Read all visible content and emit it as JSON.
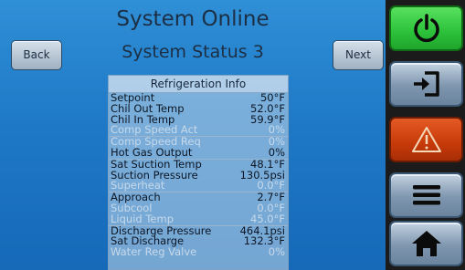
{
  "header": {
    "title": "System Online",
    "subtitle": "System Status 3"
  },
  "nav": {
    "back_label": "Back",
    "next_label": "Next"
  },
  "panel": {
    "title": "Refrigeration Info",
    "rows": [
      {
        "label": "Setpoint",
        "value": "50",
        "unit": "°F",
        "dim": false
      },
      {
        "label": "Chil Out Temp",
        "value": "52.0",
        "unit": "°F",
        "dim": false
      },
      {
        "label": "Chil In Temp",
        "value": "59.9",
        "unit": "°F",
        "dim": false
      },
      {
        "label": "Comp Speed Act",
        "value": "0",
        "unit": "%",
        "dim": true
      },
      {
        "label": "Comp Speed Req",
        "value": "0",
        "unit": "%",
        "dim": true
      },
      {
        "label": "Hot Gas Output",
        "value": "0",
        "unit": "%",
        "dim": false
      },
      {
        "label": "Sat Suction Temp",
        "value": "48.1",
        "unit": "°F",
        "dim": false
      },
      {
        "label": "Suction Pressure",
        "value": "130.5",
        "unit": "psi",
        "dim": false
      },
      {
        "label": "Superheat",
        "value": "0.0",
        "unit": "°F",
        "dim": true
      },
      {
        "label": "Approach",
        "value": "2.7",
        "unit": "°F",
        "dim": false
      },
      {
        "label": "Subcool",
        "value": "0.0",
        "unit": "°F",
        "dim": true
      },
      {
        "label": "Liquid Temp",
        "value": "45.0",
        "unit": "°F",
        "dim": true
      },
      {
        "label": "Discharge Pressure",
        "value": "464.1",
        "unit": "psi",
        "dim": false
      },
      {
        "label": "Sat Discharge",
        "value": "132.3",
        "unit": "°F",
        "dim": false
      },
      {
        "label": "Water Reg Valve",
        "value": "0",
        "unit": "%",
        "dim": true
      }
    ]
  },
  "sidebar": {
    "buttons": [
      {
        "icon": "power-icon",
        "color": "#2cc13a"
      },
      {
        "icon": "login-icon",
        "color": "#7e96ae"
      },
      {
        "icon": "warning-icon",
        "color": "#c63a0a"
      },
      {
        "icon": "menu-icon",
        "color": "#7e96ae"
      },
      {
        "icon": "home-icon",
        "color": "#7e96ae"
      }
    ]
  }
}
